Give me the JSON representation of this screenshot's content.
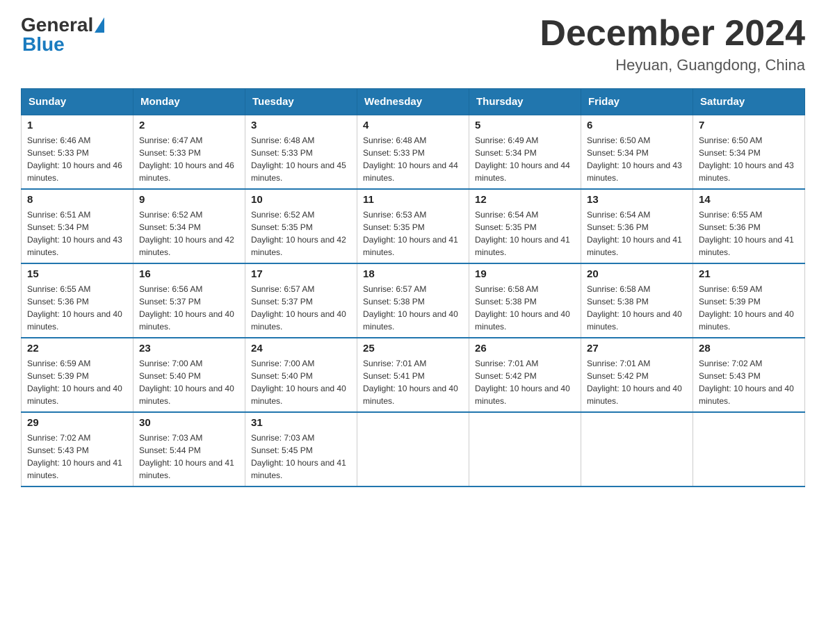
{
  "header": {
    "logo_text": "General",
    "logo_blue": "Blue",
    "title": "December 2024",
    "subtitle": "Heyuan, Guangdong, China"
  },
  "days_of_week": [
    "Sunday",
    "Monday",
    "Tuesday",
    "Wednesday",
    "Thursday",
    "Friday",
    "Saturday"
  ],
  "weeks": [
    [
      {
        "day": "1",
        "sunrise": "6:46 AM",
        "sunset": "5:33 PM",
        "daylight": "10 hours and 46 minutes."
      },
      {
        "day": "2",
        "sunrise": "6:47 AM",
        "sunset": "5:33 PM",
        "daylight": "10 hours and 46 minutes."
      },
      {
        "day": "3",
        "sunrise": "6:48 AM",
        "sunset": "5:33 PM",
        "daylight": "10 hours and 45 minutes."
      },
      {
        "day": "4",
        "sunrise": "6:48 AM",
        "sunset": "5:33 PM",
        "daylight": "10 hours and 44 minutes."
      },
      {
        "day": "5",
        "sunrise": "6:49 AM",
        "sunset": "5:34 PM",
        "daylight": "10 hours and 44 minutes."
      },
      {
        "day": "6",
        "sunrise": "6:50 AM",
        "sunset": "5:34 PM",
        "daylight": "10 hours and 43 minutes."
      },
      {
        "day": "7",
        "sunrise": "6:50 AM",
        "sunset": "5:34 PM",
        "daylight": "10 hours and 43 minutes."
      }
    ],
    [
      {
        "day": "8",
        "sunrise": "6:51 AM",
        "sunset": "5:34 PM",
        "daylight": "10 hours and 43 minutes."
      },
      {
        "day": "9",
        "sunrise": "6:52 AM",
        "sunset": "5:34 PM",
        "daylight": "10 hours and 42 minutes."
      },
      {
        "day": "10",
        "sunrise": "6:52 AM",
        "sunset": "5:35 PM",
        "daylight": "10 hours and 42 minutes."
      },
      {
        "day": "11",
        "sunrise": "6:53 AM",
        "sunset": "5:35 PM",
        "daylight": "10 hours and 41 minutes."
      },
      {
        "day": "12",
        "sunrise": "6:54 AM",
        "sunset": "5:35 PM",
        "daylight": "10 hours and 41 minutes."
      },
      {
        "day": "13",
        "sunrise": "6:54 AM",
        "sunset": "5:36 PM",
        "daylight": "10 hours and 41 minutes."
      },
      {
        "day": "14",
        "sunrise": "6:55 AM",
        "sunset": "5:36 PM",
        "daylight": "10 hours and 41 minutes."
      }
    ],
    [
      {
        "day": "15",
        "sunrise": "6:55 AM",
        "sunset": "5:36 PM",
        "daylight": "10 hours and 40 minutes."
      },
      {
        "day": "16",
        "sunrise": "6:56 AM",
        "sunset": "5:37 PM",
        "daylight": "10 hours and 40 minutes."
      },
      {
        "day": "17",
        "sunrise": "6:57 AM",
        "sunset": "5:37 PM",
        "daylight": "10 hours and 40 minutes."
      },
      {
        "day": "18",
        "sunrise": "6:57 AM",
        "sunset": "5:38 PM",
        "daylight": "10 hours and 40 minutes."
      },
      {
        "day": "19",
        "sunrise": "6:58 AM",
        "sunset": "5:38 PM",
        "daylight": "10 hours and 40 minutes."
      },
      {
        "day": "20",
        "sunrise": "6:58 AM",
        "sunset": "5:38 PM",
        "daylight": "10 hours and 40 minutes."
      },
      {
        "day": "21",
        "sunrise": "6:59 AM",
        "sunset": "5:39 PM",
        "daylight": "10 hours and 40 minutes."
      }
    ],
    [
      {
        "day": "22",
        "sunrise": "6:59 AM",
        "sunset": "5:39 PM",
        "daylight": "10 hours and 40 minutes."
      },
      {
        "day": "23",
        "sunrise": "7:00 AM",
        "sunset": "5:40 PM",
        "daylight": "10 hours and 40 minutes."
      },
      {
        "day": "24",
        "sunrise": "7:00 AM",
        "sunset": "5:40 PM",
        "daylight": "10 hours and 40 minutes."
      },
      {
        "day": "25",
        "sunrise": "7:01 AM",
        "sunset": "5:41 PM",
        "daylight": "10 hours and 40 minutes."
      },
      {
        "day": "26",
        "sunrise": "7:01 AM",
        "sunset": "5:42 PM",
        "daylight": "10 hours and 40 minutes."
      },
      {
        "day": "27",
        "sunrise": "7:01 AM",
        "sunset": "5:42 PM",
        "daylight": "10 hours and 40 minutes."
      },
      {
        "day": "28",
        "sunrise": "7:02 AM",
        "sunset": "5:43 PM",
        "daylight": "10 hours and 40 minutes."
      }
    ],
    [
      {
        "day": "29",
        "sunrise": "7:02 AM",
        "sunset": "5:43 PM",
        "daylight": "10 hours and 41 minutes."
      },
      {
        "day": "30",
        "sunrise": "7:03 AM",
        "sunset": "5:44 PM",
        "daylight": "10 hours and 41 minutes."
      },
      {
        "day": "31",
        "sunrise": "7:03 AM",
        "sunset": "5:45 PM",
        "daylight": "10 hours and 41 minutes."
      },
      null,
      null,
      null,
      null
    ]
  ]
}
